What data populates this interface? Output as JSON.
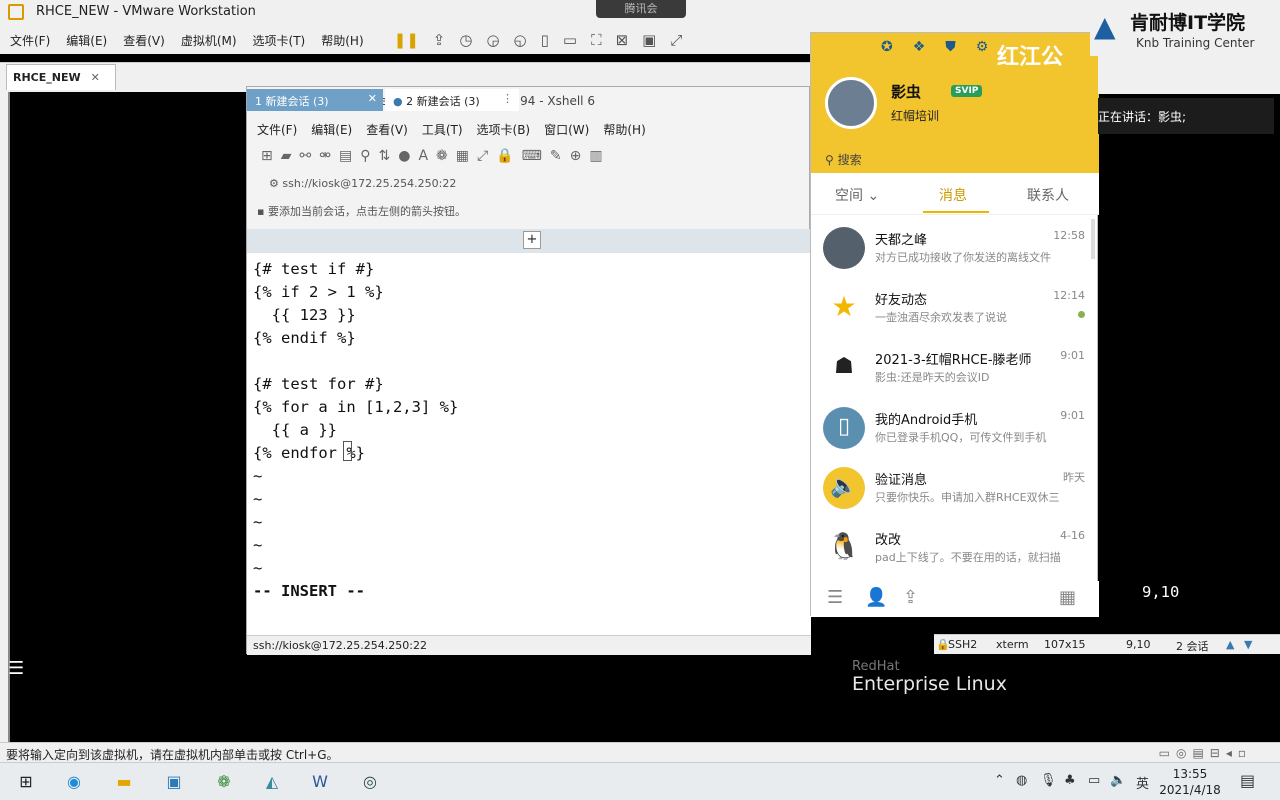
{
  "vmware": {
    "title": "RHCE_NEW - VMware Workstation",
    "banner": "腾讯会",
    "menu": [
      "文件(F)",
      "编辑(E)",
      "查看(V)",
      "虚拟机(M)",
      "选项卡(T)",
      "帮助(H)"
    ],
    "tab_label": "RHCE_NEW",
    "status_text": "要将输入定向到该虚拟机，请在虚拟机内部单击或按 Ctrl+G。",
    "rhel_small": "RedHat",
    "rhel_logo": "Enterprise Linux"
  },
  "xshell": {
    "title": "新建会话 (3) - student@workstation:~/rh294 - Xshell 6",
    "menu": [
      "文件(F)",
      "编辑(E)",
      "查看(V)",
      "工具(T)",
      "选项卡(B)",
      "窗口(W)",
      "帮助(H)"
    ],
    "address": "ssh://kiosk@172.25.254.250:22",
    "hint": "要添加当前会话，点击左侧的箭头按钮。",
    "tabs": [
      "1 新建会话 (3)",
      "2 新建会话 (3)"
    ],
    "terminal_lines": [
      "{# test if #}",
      "{% if 2 > 1 %}",
      "  {{ 123 }}",
      "{% endif %}",
      "",
      "{# test for #}",
      "{% for a in [1,2,3] %}",
      "  {{ a }}",
      "{% endfor %}",
      "~",
      "~",
      "~",
      "~",
      "~",
      "",
      "-- INSERT --"
    ],
    "cursor_pos": "9,10",
    "status": {
      "address": "ssh://kiosk@172.25.254.250:22",
      "protocol": "SSH2",
      "term": "xterm",
      "size": "107x15",
      "pos": "9,10",
      "sessions": "2 会话"
    }
  },
  "qq": {
    "brand": "红江公",
    "name": "影虫",
    "vip": "SVIP",
    "signature": "红帽培训",
    "search": "搜索",
    "tabs": [
      "空间",
      "消息",
      "联系人"
    ],
    "conversations": [
      {
        "name": "天都之峰",
        "time": "12:58",
        "preview": "对方已成功接收了你发送的离线文件",
        "color": "#54606c"
      },
      {
        "name": "好友动态",
        "time": "12:14",
        "preview": "一壶浊酒尽余欢发表了说说",
        "color": "#f2c42e"
      },
      {
        "name": "2021-3-红帽RHCE-滕老师",
        "time": "9:01",
        "preview": "影虫:还是昨天的会议ID",
        "color": "#ffffff"
      },
      {
        "name": "我的Android手机",
        "time": "9:01",
        "preview": "你已登录手机QQ，可传文件到手机",
        "color": "#5b8fb0"
      },
      {
        "name": "验证消息",
        "time": "昨天",
        "preview": "只要你快乐。申请加入群RHCE双休三",
        "color": "#f2c42e"
      },
      {
        "name": "改改",
        "time": "4-16",
        "preview": "pad上下线了。不要在用的话，就扫描",
        "color": "#ffffff"
      }
    ]
  },
  "overlay": {
    "logo_cn": "肯耐博IT学院",
    "logo_en": "Knb Training Center",
    "speaking": "正在讲话：影虫;"
  },
  "taskbar": {
    "lang": "英",
    "time": "13:55",
    "date": "2021/4/18"
  }
}
